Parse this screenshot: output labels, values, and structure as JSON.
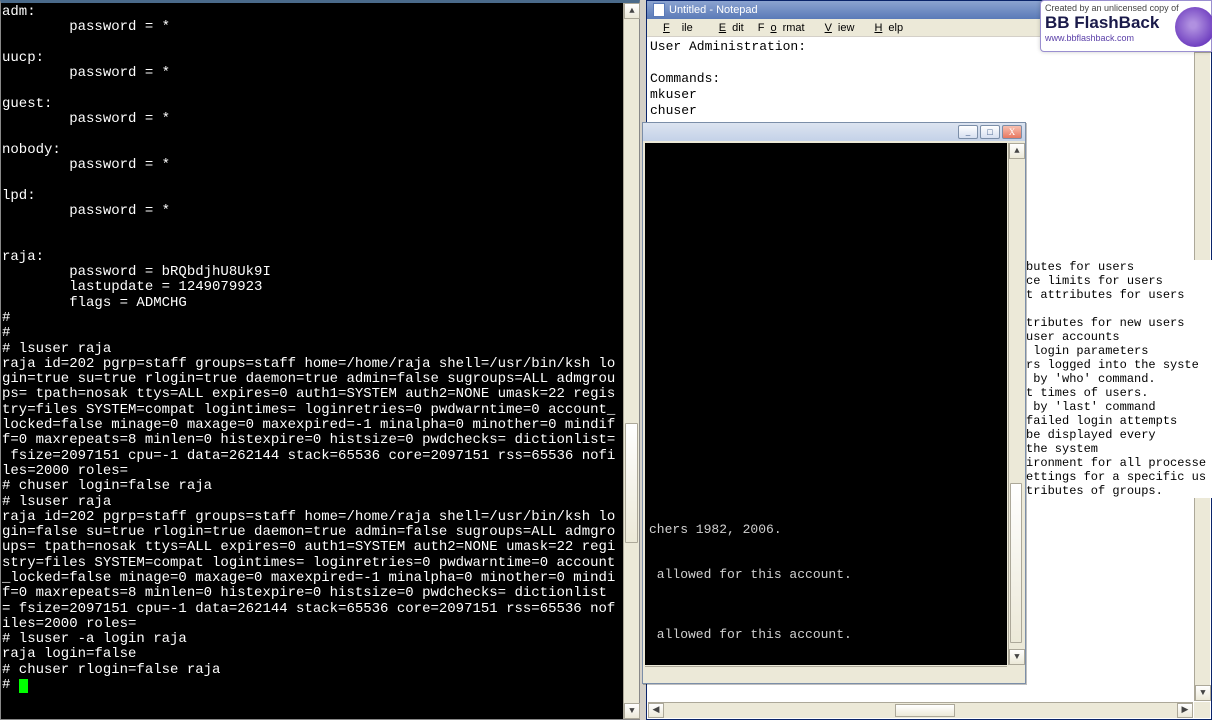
{
  "watermark": {
    "tagline": "Created by an unlicensed copy of",
    "brand": "BB FlashBack",
    "url": "www.bbflashback.com"
  },
  "notepad": {
    "title": "Untitled - Notepad",
    "menu": {
      "file": "File",
      "edit": "Edit",
      "format": "Format",
      "view": "View",
      "help": "Help"
    },
    "body": "User Administration:\n\nCommands:\nmkuser\nchuser\nrmuser\nlsuser"
  },
  "right_fragment": "butes for users\nce limits for users\nt attributes for users\n\ntributes for new users\nuser accounts\n login parameters\nrs logged into the syste\n by 'who' command.\nt times of users.\n by 'last' command\nfailed login attempts\nbe displayed every\nthe system\nironment for all processe\nettings for a specific us\ntributes of groups.",
  "term_left": {
    "lines": "adm:\n        password = *\n\nuucp:\n        password = *\n\nguest:\n        password = *\n\nnobody:\n        password = *\n\nlpd:\n        password = *\n\n\nraja:\n        password = bRQbdjhU8Uk9I\n        lastupdate = 1249079923\n        flags = ADMCHG\n#\n#\n# lsuser raja\nraja id=202 pgrp=staff groups=staff home=/home/raja shell=/usr/bin/ksh lo\ngin=true su=true rlogin=true daemon=true admin=false sugroups=ALL admgrou\nps= tpath=nosak ttys=ALL expires=0 auth1=SYSTEM auth2=NONE umask=22 regis\ntry=files SYSTEM=compat logintimes= loginretries=0 pwdwarntime=0 account_\nlocked=false minage=0 maxage=0 maxexpired=-1 minalpha=0 minother=0 mindif\nf=0 maxrepeats=8 minlen=0 histexpire=0 histsize=0 pwdchecks= dictionlist=\n fsize=2097151 cpu=-1 data=262144 stack=65536 core=2097151 rss=65536 nofi\nles=2000 roles=\n# chuser login=false raja\n# lsuser raja\nraja id=202 pgrp=staff groups=staff home=/home/raja shell=/usr/bin/ksh lo\ngin=false su=true rlogin=true daemon=true admin=false sugroups=ALL admgro\nups= tpath=nosak ttys=ALL expires=0 auth1=SYSTEM auth2=NONE umask=22 regi\nstry=files SYSTEM=compat logintimes= loginretries=0 pwdwarntime=0 account\n_locked=false minage=0 maxage=0 maxexpired=-1 minalpha=0 minother=0 mindi\nf=0 maxrepeats=8 minlen=0 histexpire=0 histsize=0 pwdchecks= dictionlist\n= fsize=2097151 cpu=-1 data=262144 stack=65536 core=2097151 rss=65536 nof\niles=2000 roles=\n# lsuser -a login raja\nraja login=false\n# chuser rlogin=false raja\n# "
  },
  "term_inner": {
    "lines": "\n\n\n\n\n\n\n\n\n\n\n\n\n\n\n\n\n\n\n\n\n\n\n\n\nchers 1982, 2006.\n\n\n allowed for this account.\n\n\n\n allowed for this account."
  },
  "win_buttons": {
    "min": "_",
    "max": "□",
    "close": "X"
  },
  "scroll_glyphs": {
    "up": "▲",
    "down": "▼",
    "left": "◀",
    "right": "▶"
  }
}
